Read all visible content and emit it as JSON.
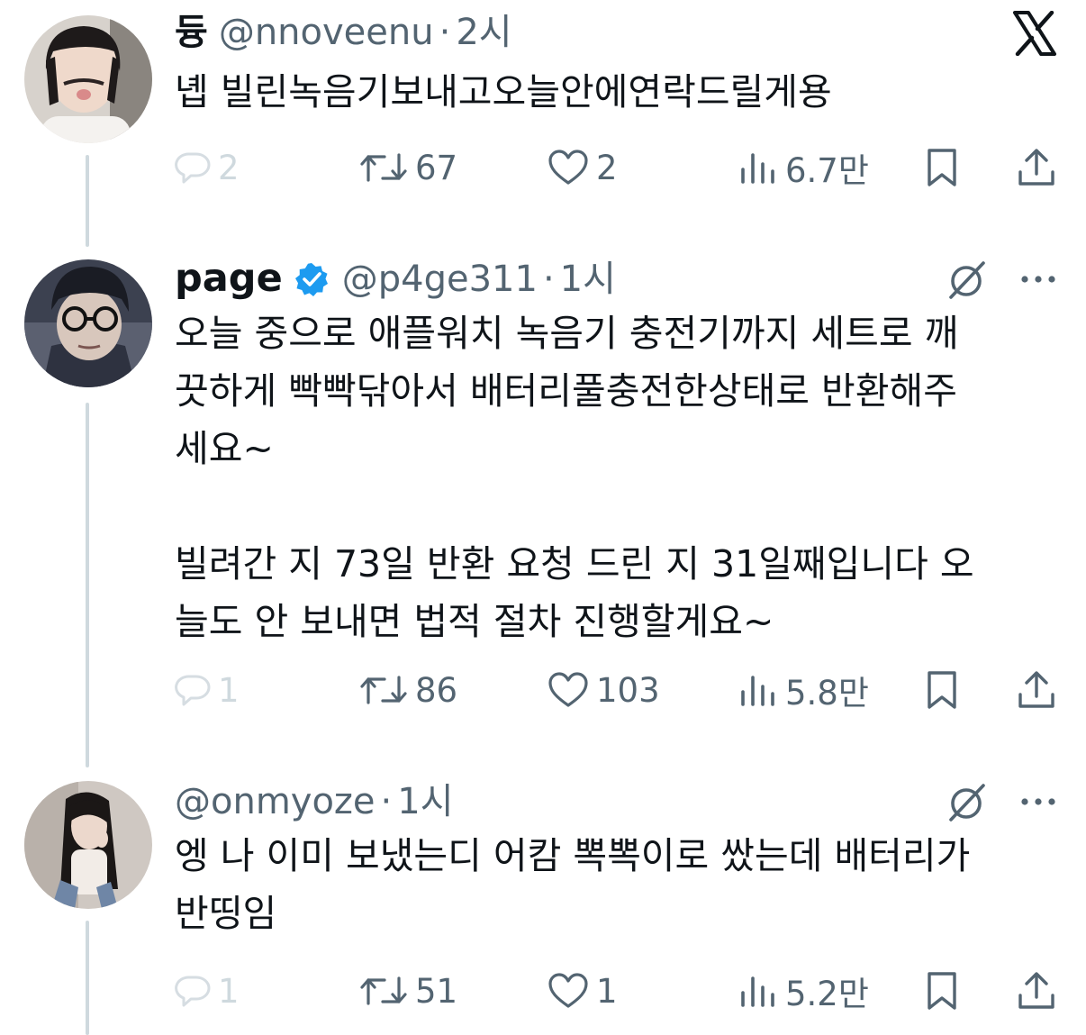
{
  "app": {
    "logo": "x-logo",
    "colors": {
      "text": "#0f1419",
      "secondary": "#536471",
      "verified": "#1d9bf0",
      "muted": "#cfd9de"
    }
  },
  "tweets": [
    {
      "name": "듕",
      "handle": "@nnoveenu",
      "separator": "·",
      "time": "2시",
      "verified": false,
      "body": [
        "녭 빌린녹음기보내고오늘안에연락드릴게용"
      ],
      "stats": {
        "replies": "2",
        "retweets": "67",
        "likes": "2",
        "views": "6.7만"
      }
    },
    {
      "name": "page",
      "handle": "@p4ge311",
      "separator": "·",
      "time": "1시",
      "verified": true,
      "body": [
        "오늘 중으로 애플워치 녹음기 충전기까지 세트로 깨",
        "끗하게 빡빡닦아서 배터리풀충전한상태로 반환해주",
        "세요~",
        "",
        "빌려간 지 73일 반환 요청 드린 지 31일째입니다 오",
        "늘도 안 보내면 법적 절차 진행할게요~"
      ],
      "stats": {
        "replies": "1",
        "retweets": "86",
        "likes": "103",
        "views": "5.8만"
      }
    },
    {
      "name": "",
      "handle": "@onmyoze",
      "separator": "·",
      "time": "1시",
      "verified": false,
      "body": [
        "엥 나 이미 보냈는디 어캄 뽁뽁이로 쌌는데 배터리가",
        "반띵임"
      ],
      "stats": {
        "replies": "1",
        "retweets": "51",
        "likes": "1",
        "views": "5.2만"
      }
    }
  ]
}
